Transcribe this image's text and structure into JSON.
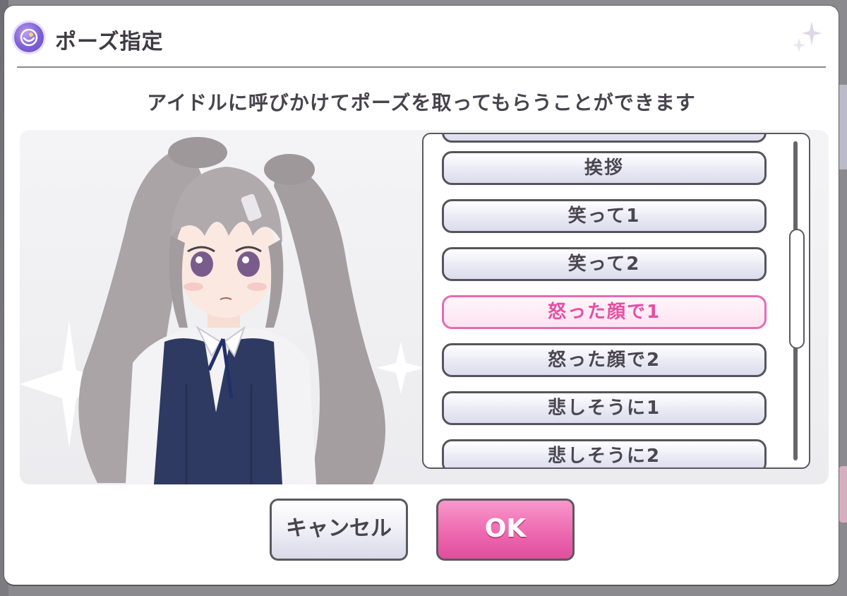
{
  "dialog": {
    "title": "ポーズ指定",
    "instruction": "アイドルに呼びかけてポーズを取ってもらうことができます"
  },
  "pose_list": {
    "items": [
      {
        "label": "挨拶",
        "selected": false
      },
      {
        "label": "笑って1",
        "selected": false
      },
      {
        "label": "笑って2",
        "selected": false
      },
      {
        "label": "怒った顔で1",
        "selected": true
      },
      {
        "label": "怒った顔で2",
        "selected": false
      },
      {
        "label": "悲しそうに1",
        "selected": false
      },
      {
        "label": "悲しそうに2",
        "selected": false
      }
    ]
  },
  "buttons": {
    "cancel_label": "キャンセル",
    "ok_label": "OK"
  },
  "colors": {
    "accent_pink": "#e64fa3",
    "selected_border": "#e76bb3",
    "ok_button": "#ee69b0",
    "icon_purple": "#7d5fd6"
  },
  "icons": {
    "title_icon": "pose-badge-icon",
    "corner_icon": "sparkle-icon"
  }
}
